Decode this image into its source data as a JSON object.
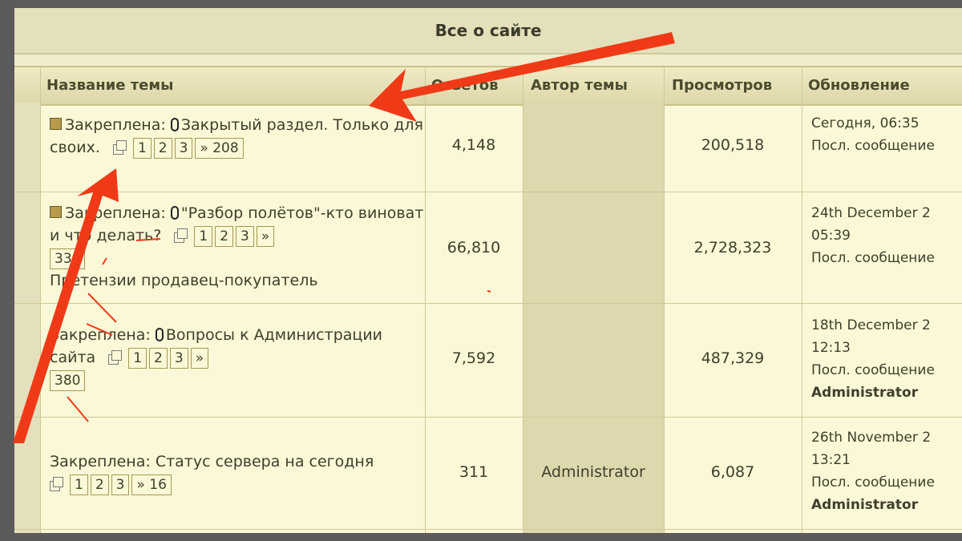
{
  "forum": {
    "title": "Все о сайте"
  },
  "columns": {
    "topic": "Название темы",
    "replies": "Ответов",
    "author": "Автор темы",
    "views": "Просмотров",
    "updated": "Обновление"
  },
  "topics": [
    {
      "prefix": "Закреплена:",
      "title": "Закрытый раздел. Только для своих.",
      "pages": [
        "1",
        "2",
        "3",
        "» 208"
      ],
      "replies": "4,148",
      "author": "",
      "views": "200,518",
      "date": "Сегодня, 06:35",
      "last_post": "Посл. сообщение",
      "last_user": ""
    },
    {
      "prefix": "Закреплена:",
      "title": "\"Разбор полётов\"-кто виноват и что делать?",
      "pages": [
        "1",
        "2",
        "3",
        "»",
        "334"
      ],
      "subtitle": "Претензии продавец-покупатель",
      "replies": "66,810",
      "author": "",
      "views": "2,728,323",
      "date": "24th December 2",
      "time": "05:39",
      "last_post": "Посл. сообщение",
      "last_user": ""
    },
    {
      "prefix": "Закреплена:",
      "title": "Вопросы к Администрации сайта",
      "pages": [
        "1",
        "2",
        "3",
        "»",
        "380"
      ],
      "replies": "7,592",
      "author": "",
      "views": "487,329",
      "date": "18th December 2",
      "time": "12:13",
      "last_post": "Посл. сообщение",
      "last_user": "Administrator"
    },
    {
      "prefix": "Закреплена:",
      "title": "Статус сервера на сегодня",
      "pages": [
        "1",
        "2",
        "3",
        "» 16"
      ],
      "replies": "311",
      "author": "Administrator",
      "views": "6,087",
      "date": "26th November 2",
      "time": "13:21",
      "last_post": "Посл. сообщение",
      "last_user": "Administrator"
    }
  ],
  "colors": {
    "annotation_arrow": "#f03a17",
    "header_bg": "#e4e0bb",
    "row_bg": "#fbf8d8"
  }
}
